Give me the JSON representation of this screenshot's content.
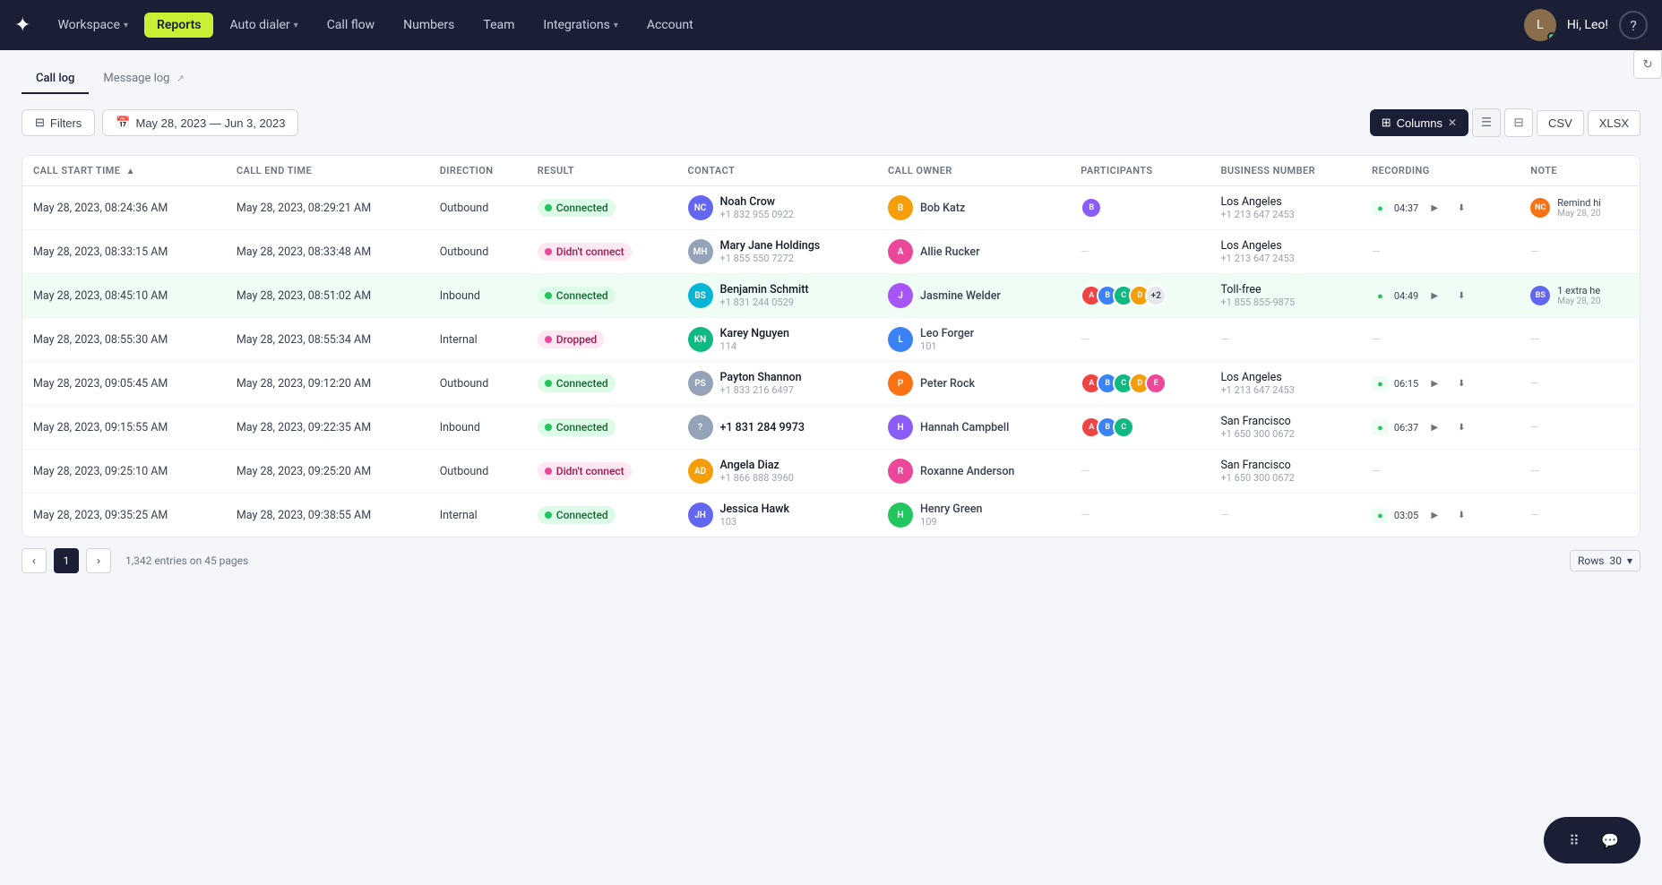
{
  "nav": {
    "logo": "✦",
    "items": [
      {
        "label": "Workspace",
        "hasDropdown": true,
        "active": false
      },
      {
        "label": "Reports",
        "hasDropdown": false,
        "active": true
      },
      {
        "label": "Auto dialer",
        "hasDropdown": true,
        "active": false
      },
      {
        "label": "Call flow",
        "hasDropdown": false,
        "active": false
      },
      {
        "label": "Numbers",
        "hasDropdown": false,
        "active": false
      },
      {
        "label": "Team",
        "hasDropdown": false,
        "active": false
      },
      {
        "label": "Integrations",
        "hasDropdown": true,
        "active": false
      },
      {
        "label": "Account",
        "hasDropdown": false,
        "active": false
      }
    ],
    "greeting": "Hi, Leo!",
    "help_icon": "?"
  },
  "tabs": [
    {
      "label": "Call log",
      "active": true
    },
    {
      "label": "Message log",
      "active": false,
      "icon": "↗"
    }
  ],
  "toolbar": {
    "filter_label": "Filters",
    "date_range": "May 28, 2023 — Jun 3, 2023",
    "columns_label": "Columns",
    "view_list_icon": "≡",
    "view_grid_icon": "⊟",
    "export_csv": "CSV",
    "export_xlsx": "XLSX",
    "refresh_icon": "↻"
  },
  "table": {
    "columns": [
      {
        "key": "call_start",
        "label": "Call Start Time",
        "sortable": true
      },
      {
        "key": "call_end",
        "label": "Call End Time",
        "sortable": false
      },
      {
        "key": "direction",
        "label": "Direction",
        "sortable": false
      },
      {
        "key": "result",
        "label": "Result",
        "sortable": false
      },
      {
        "key": "contact",
        "label": "Contact",
        "sortable": false
      },
      {
        "key": "owner",
        "label": "Call Owner",
        "sortable": false
      },
      {
        "key": "participants",
        "label": "Participants",
        "sortable": false
      },
      {
        "key": "biz_number",
        "label": "Business Number",
        "sortable": false
      },
      {
        "key": "recording",
        "label": "Recording",
        "sortable": false
      },
      {
        "key": "note",
        "label": "Note",
        "sortable": false
      }
    ],
    "rows": [
      {
        "call_start": "May 28, 2023, 08:24:36 AM",
        "call_end": "May 28, 2023, 08:29:21 AM",
        "direction": "Outbound",
        "result": "Connected",
        "result_type": "connected",
        "contact_initials": "NC",
        "contact_name": "Noah Crow",
        "contact_phone": "+1 832 955 0922",
        "contact_color": "#6366f1",
        "owner_name": "Bob Katz",
        "owner_color": "#f59e0b",
        "participants": [
          {
            "color": "#8b5cf6",
            "initials": "B"
          }
        ],
        "participants_more": 0,
        "biz_city": "Los Angeles",
        "biz_number": "+1 213 647 2453",
        "recording_time": "04:37",
        "has_recording": true,
        "note_text": "Remind hi",
        "note_date": "May 28, 20",
        "note_avatar_color": "#f97316"
      },
      {
        "call_start": "May 28, 2023, 08:33:15 AM",
        "call_end": "May 28, 2023, 08:33:48 AM",
        "direction": "Outbound",
        "result": "Didn't connect",
        "result_type": "didnt",
        "contact_initials": "MH",
        "contact_name": "Mary Jane Holdings",
        "contact_phone": "+1 855 550 7272",
        "contact_color": "#94a3b8",
        "owner_name": "Allie Rucker",
        "owner_color": "#ec4899",
        "participants": [],
        "participants_more": 0,
        "biz_city": "Los Angeles",
        "biz_number": "+1 213 647 2453",
        "recording_time": "",
        "has_recording": false,
        "note_text": "",
        "note_date": "",
        "note_avatar_color": ""
      },
      {
        "call_start": "May 28, 2023, 08:45:10 AM",
        "call_end": "May 28, 2023, 08:51:02 AM",
        "direction": "Inbound",
        "result": "Connected",
        "result_type": "connected",
        "contact_initials": "BS",
        "contact_name": "Benjamin Schmitt",
        "contact_phone": "+1 831 244 0529",
        "contact_color": "#06b6d4",
        "owner_name": "Jasmine Welder",
        "owner_color": "#a855f7",
        "participants": [
          {
            "color": "#ef4444",
            "initials": "A"
          },
          {
            "color": "#3b82f6",
            "initials": "B"
          },
          {
            "color": "#10b981",
            "initials": "C"
          },
          {
            "color": "#f59e0b",
            "initials": "D"
          }
        ],
        "participants_more": 2,
        "biz_city": "Toll-free",
        "biz_number": "+1 855 855-9875",
        "recording_time": "04:49",
        "has_recording": true,
        "note_text": "1 extra he",
        "note_date": "May 28, 20",
        "note_avatar_color": "#6366f1",
        "row_highlight": true
      },
      {
        "call_start": "May 28, 2023, 08:55:30 AM",
        "call_end": "May 28, 2023, 08:55:34 AM",
        "direction": "Internal",
        "result": "Dropped",
        "result_type": "dropped",
        "contact_initials": "KN",
        "contact_name": "Karey Nguyen",
        "contact_phone": "114",
        "contact_color": "#10b981",
        "owner_name": "Leo Forger",
        "owner_color": "#3b82f6",
        "owner_phone": "101",
        "participants": [],
        "participants_more": 0,
        "biz_city": "",
        "biz_number": "",
        "recording_time": "",
        "has_recording": false,
        "note_text": "",
        "note_date": "",
        "note_avatar_color": ""
      },
      {
        "call_start": "May 28, 2023, 09:05:45 AM",
        "call_end": "May 28, 2023, 09:12:20 AM",
        "direction": "Outbound",
        "result": "Connected",
        "result_type": "connected",
        "contact_initials": "PS",
        "contact_name": "Payton Shannon",
        "contact_phone": "+1 833 216 6497",
        "contact_color": "#94a3b8",
        "owner_name": "Peter Rock",
        "owner_color": "#f97316",
        "participants": [
          {
            "color": "#ef4444",
            "initials": "A"
          },
          {
            "color": "#3b82f6",
            "initials": "B"
          },
          {
            "color": "#10b981",
            "initials": "C"
          },
          {
            "color": "#f59e0b",
            "initials": "D"
          },
          {
            "color": "#ec4899",
            "initials": "E"
          }
        ],
        "participants_more": 0,
        "biz_city": "Los Angeles",
        "biz_number": "+1 213 647 2453",
        "recording_time": "06:15",
        "has_recording": true,
        "note_text": "",
        "note_date": "",
        "note_avatar_color": ""
      },
      {
        "call_start": "May 28, 2023, 09:15:55 AM",
        "call_end": "May 28, 2023, 09:22:35 AM",
        "direction": "Inbound",
        "result": "Connected",
        "result_type": "connected",
        "contact_initials": "",
        "contact_name": "+1 831 284 9973",
        "contact_phone": "",
        "contact_color": "#94a3b8",
        "owner_name": "Hannah Campbell",
        "owner_color": "#8b5cf6",
        "participants": [
          {
            "color": "#ef4444",
            "initials": "A"
          },
          {
            "color": "#3b82f6",
            "initials": "B"
          },
          {
            "color": "#10b981",
            "initials": "C"
          }
        ],
        "participants_more": 0,
        "biz_city": "San Francisco",
        "biz_number": "+1 650 300 0672",
        "recording_time": "06:37",
        "has_recording": true,
        "note_text": "",
        "note_date": "",
        "note_avatar_color": ""
      },
      {
        "call_start": "May 28, 2023, 09:25:10 AM",
        "call_end": "May 28, 2023, 09:25:20 AM",
        "direction": "Outbound",
        "result": "Didn't connect",
        "result_type": "didnt",
        "contact_initials": "AD",
        "contact_name": "Angela Diaz",
        "contact_phone": "+1 866 888 3960",
        "contact_color": "#f59e0b",
        "owner_name": "Roxanne Anderson",
        "owner_color": "#ec4899",
        "participants": [],
        "participants_more": 0,
        "biz_city": "San Francisco",
        "biz_number": "+1 650 300 0672",
        "recording_time": "",
        "has_recording": false,
        "note_text": "",
        "note_date": "",
        "note_avatar_color": ""
      },
      {
        "call_start": "May 28, 2023, 09:35:25 AM",
        "call_end": "May 28, 2023, 09:38:55 AM",
        "direction": "Internal",
        "result": "Connected",
        "result_type": "connected",
        "contact_initials": "JH",
        "contact_name": "Jessica Hawk",
        "contact_phone": "103",
        "contact_color": "#6366f1",
        "owner_name": "Henry Green",
        "owner_color": "#22c55e",
        "owner_phone": "109",
        "participants": [],
        "participants_more": 0,
        "biz_city": "",
        "biz_number": "",
        "recording_time": "03:05",
        "has_recording": true,
        "note_text": "",
        "note_date": "",
        "note_avatar_color": ""
      }
    ]
  },
  "pagination": {
    "current_page": 1,
    "total_info": "1,342 entries on 45 pages",
    "rows_label": "Rows",
    "rows_value": "30"
  }
}
